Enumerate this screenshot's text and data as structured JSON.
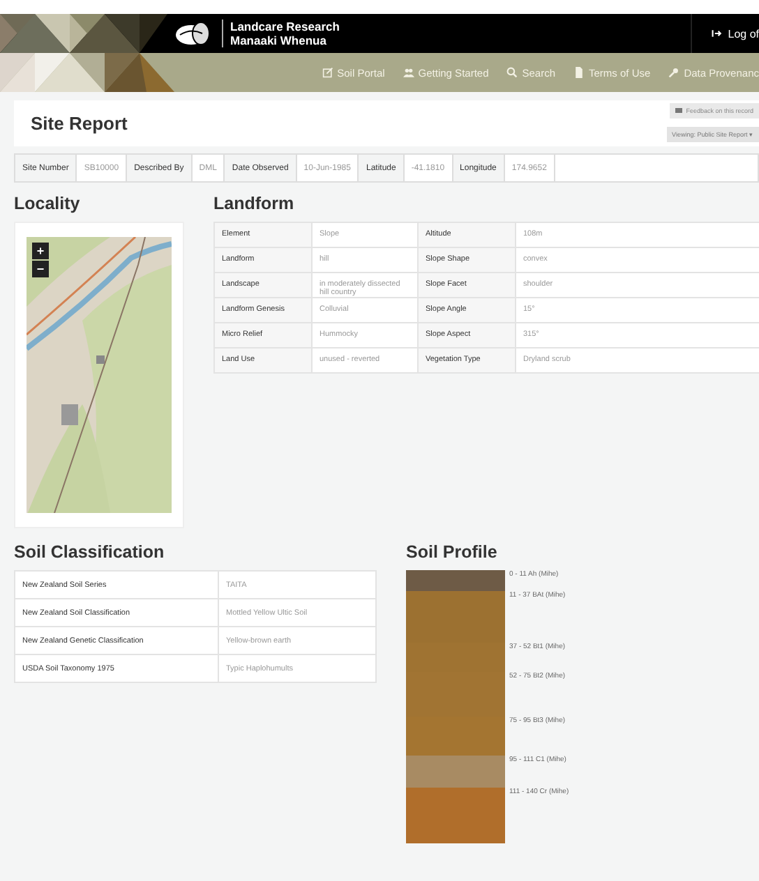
{
  "header": {
    "brand_line_1": "Landcare Research",
    "brand_line_2": "Manaaki Whenua",
    "logoff": "Log of"
  },
  "nav": [
    {
      "label": "Soil Portal"
    },
    {
      "label": "Getting Started"
    },
    {
      "label": "Search"
    },
    {
      "label": "Terms of Use"
    },
    {
      "label": "Data Provenanc"
    }
  ],
  "page_title": "Site Report",
  "feedback_button": "Feedback on this record",
  "view_dropdown": "Viewing: Public Site Report",
  "view_caret": "▾",
  "site_info": [
    {
      "label": "Site Number",
      "value": "SB10000"
    },
    {
      "label": "Described By",
      "value": "DML"
    },
    {
      "label": "Date Observed",
      "value": "10-Jun-1985"
    },
    {
      "label": "Latitude",
      "value": "-41.1810"
    },
    {
      "label": "Longitude",
      "value": "174.9652"
    }
  ],
  "locality": {
    "title": "Locality",
    "zoom_in": "+",
    "zoom_out": "−"
  },
  "landform": {
    "title": "Landform",
    "rows": [
      {
        "label_1": "Element",
        "value_1": "Slope",
        "label_2": "Altitude",
        "value_2": "108m"
      },
      {
        "label_1": "Landform",
        "value_1": "hill",
        "label_2": "Slope Shape",
        "value_2": "convex"
      },
      {
        "label_1": "Landscape",
        "value_1": "in moderately dissected hill country",
        "label_2": "Slope Facet",
        "value_2": "shoulder"
      },
      {
        "label_1": "Landform Genesis",
        "value_1": "Colluvial",
        "label_2": "Slope Angle",
        "value_2": "15°"
      },
      {
        "label_1": "Micro Relief",
        "value_1": "Hummocky",
        "label_2": "Slope Aspect",
        "value_2": "315°"
      },
      {
        "label_1": "Land Use",
        "value_1": "unused - reverted",
        "label_2": "Vegetation Type",
        "value_2": "Dryland scrub"
      }
    ]
  },
  "soil_classification": {
    "title": "Soil Classification",
    "rows": [
      {
        "label": "New Zealand Soil Series",
        "value": "TAITA"
      },
      {
        "label": "New Zealand Soil Classification",
        "value": "Mottled Yellow Ultic Soil"
      },
      {
        "label": "New Zealand Genetic Classification",
        "value": "Yellow-brown earth"
      },
      {
        "label": "USDA Soil Taxonomy 1975",
        "value": "Typic Haplohumults"
      }
    ]
  },
  "soil_profile": {
    "title": "Soil Profile",
    "horizons": [
      {
        "label": "0 - 11 Ah (Mihe)",
        "color": "#6e5b46"
      },
      {
        "label": "11 - 37 BAt (Mihe)",
        "color": "#9c7131"
      },
      {
        "label": "37 - 52 Bt1 (Mihe)",
        "color": "#9f7332"
      },
      {
        "label": "52 - 75 Bt2 (Mihe)",
        "color": "#a17433"
      },
      {
        "label": "75 - 95 Bt3 (Mihe)",
        "color": "#a47531"
      },
      {
        "label": "95 - 111 C1 (Mihe)",
        "color": "#a88b63"
      },
      {
        "label": "111 - 140 Cr (Mihe)",
        "color": "#b06e2b"
      }
    ]
  }
}
